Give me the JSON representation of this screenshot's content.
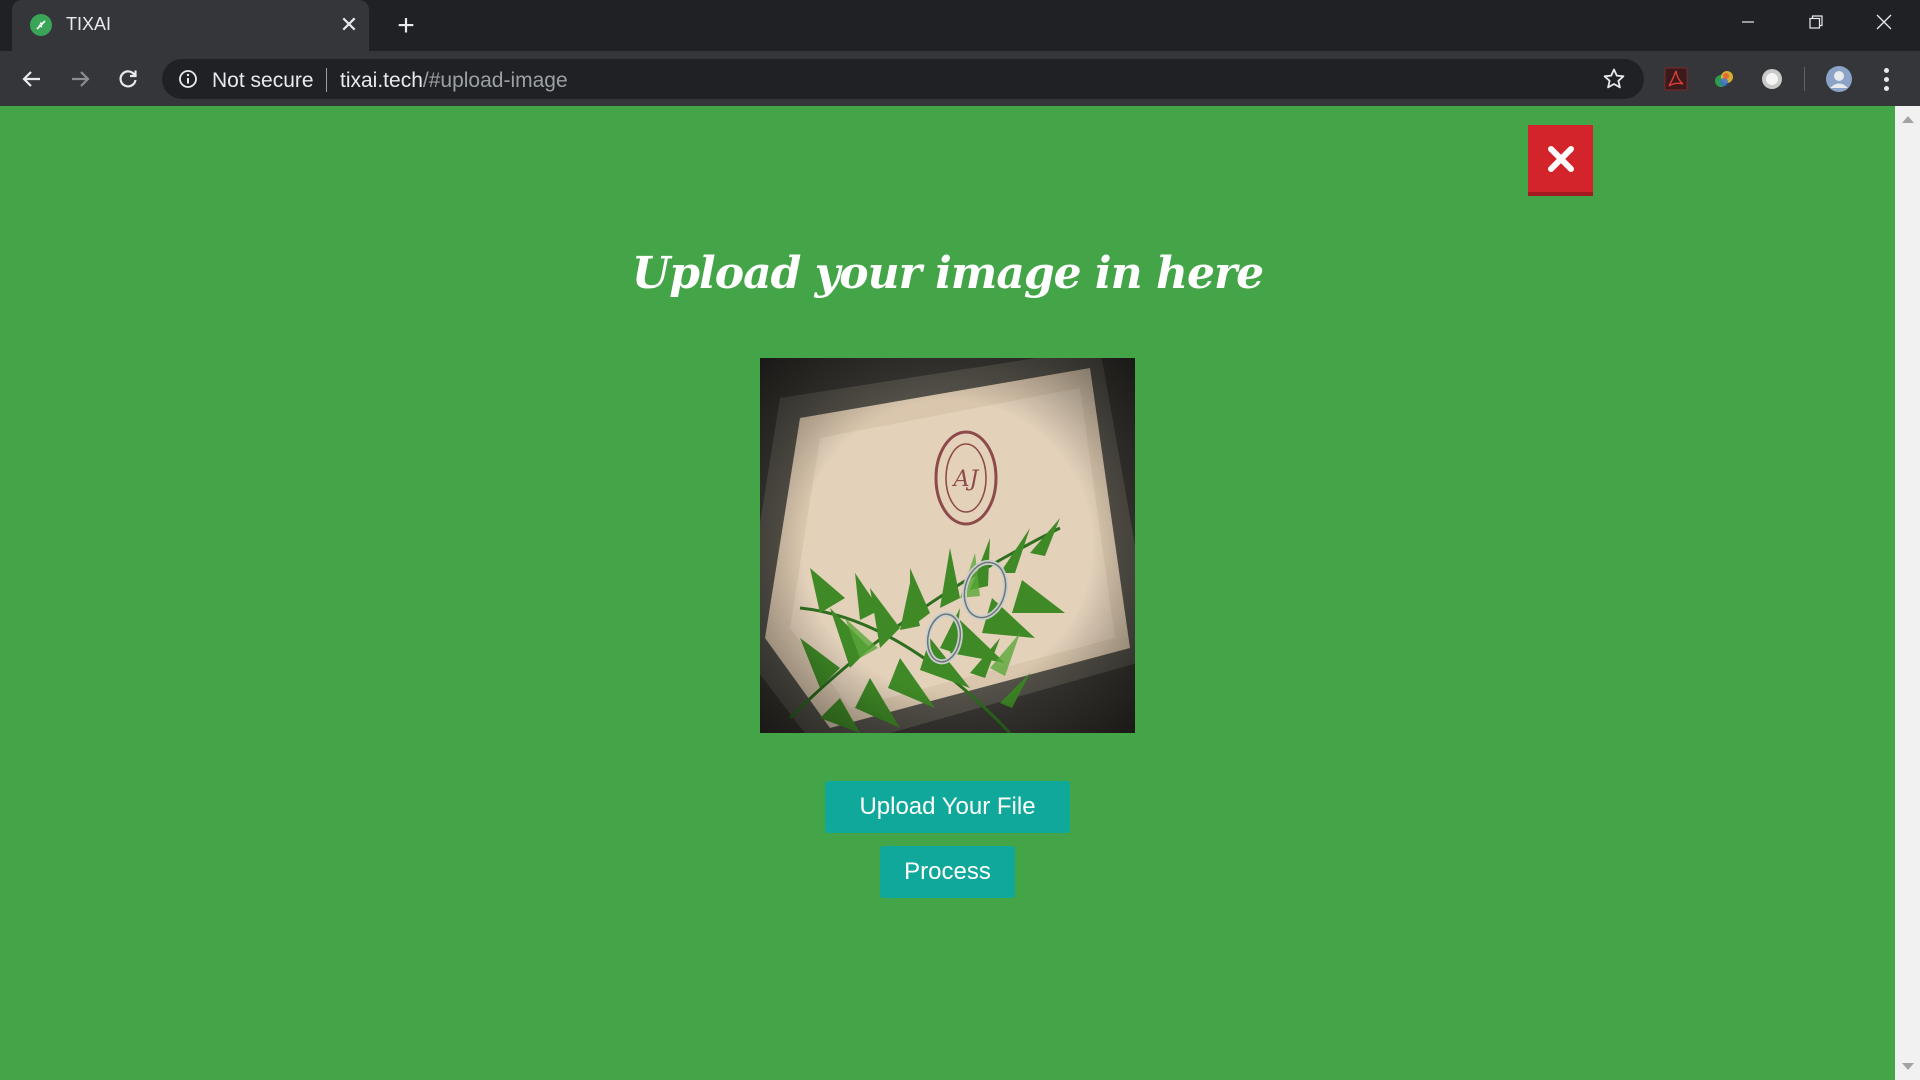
{
  "browser": {
    "tab": {
      "title": "TIXAI",
      "close_glyph": "✕"
    },
    "new_tab_glyph": "+",
    "omnibox": {
      "security_label": "Not secure",
      "url_host": "tixai.tech",
      "url_path": "/#upload-image"
    },
    "extensions": [
      "pdf-extension-icon",
      "color-extension-icon",
      "circle-extension-icon"
    ],
    "accent": "#35363a"
  },
  "page": {
    "background": "#43a548",
    "heading": "Upload your image in here",
    "close_button": {
      "icon": "close-x-icon",
      "color": "#d3232b"
    },
    "image": {
      "description_icon": "uploaded-image-preview"
    },
    "buttons": {
      "upload": "Upload Your File",
      "process": "Process"
    },
    "button_color": "#0fa89a"
  }
}
